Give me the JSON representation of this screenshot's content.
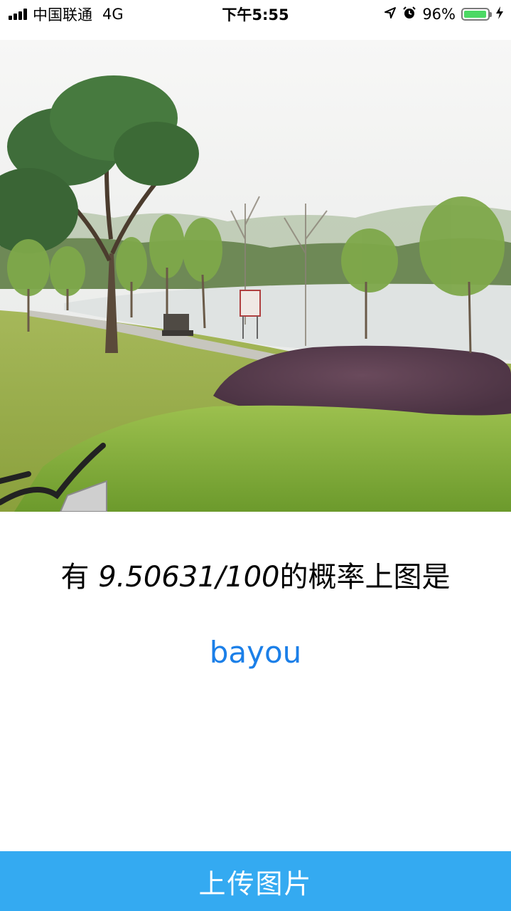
{
  "status_bar": {
    "carrier": "中国联通",
    "network": "4G",
    "time": "下午5:55",
    "battery_percent": "96%",
    "battery_level": 0.96,
    "icons": [
      "signal-icon",
      "location-icon",
      "alarm-icon",
      "battery-icon",
      "charging-icon"
    ]
  },
  "photo": {
    "description_icon": "landscape-photo"
  },
  "result": {
    "prefix": "有 ",
    "probability": "9.50631/100",
    "suffix": "的概率上图是",
    "label": "bayou"
  },
  "button": {
    "upload_label": "上传图片"
  },
  "colors": {
    "accent": "#34aaf1",
    "label_blue": "#1b7fe8",
    "battery_green": "#4cd964"
  }
}
